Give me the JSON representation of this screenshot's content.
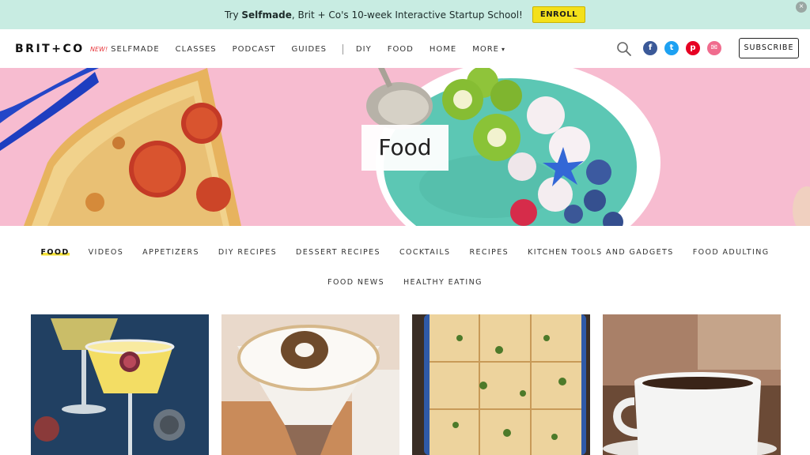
{
  "promo": {
    "text_prefix": "Try ",
    "text_bold": "Selfmade",
    "text_suffix": ", Brit + Co's 10-week Interactive Startup School!",
    "cta_label": "ENROLL",
    "close_icon": "close-icon"
  },
  "header": {
    "logo": "BRIT+CO",
    "new_badge": "NEW!",
    "nav": [
      {
        "label": "SELFMADE"
      },
      {
        "label": "CLASSES"
      },
      {
        "label": "PODCAST"
      },
      {
        "label": "GUIDES"
      },
      {
        "label": "DIY"
      },
      {
        "label": "FOOD"
      },
      {
        "label": "HOME"
      },
      {
        "label": "MORE"
      }
    ],
    "more_icon": "chevron-down-icon",
    "search_icon": "search-icon",
    "social": [
      {
        "icon": "facebook-icon",
        "glyph": "f",
        "color": "#3b5998"
      },
      {
        "icon": "twitter-icon",
        "glyph": "t",
        "color": "#1da1f2"
      },
      {
        "icon": "pinterest-icon",
        "glyph": "p",
        "color": "#e60023"
      },
      {
        "icon": "email-icon",
        "glyph": "✉",
        "color": "#f06c8e"
      }
    ],
    "subscribe_label": "SUBSCRIBE"
  },
  "hero": {
    "title": "Food",
    "background_color": "#f7bcd0"
  },
  "categories": {
    "row1": [
      "FOOD",
      "VIDEOS",
      "APPETIZERS",
      "DIY RECIPES",
      "DESSERT RECIPES",
      "COCKTAILS",
      "RECIPES",
      "KITCHEN TOOLS AND GADGETS",
      "FOOD ADULTING"
    ],
    "row2": [
      "FOOD NEWS",
      "HEALTHY EATING"
    ],
    "active": "FOOD",
    "highlight_color": "#f5e23a"
  },
  "cards": [
    {
      "image": "margarita-cocktail-image"
    },
    {
      "image": "coconut-cookie-dessert-image"
    },
    {
      "image": "baked-casserole-image"
    },
    {
      "image": "coffee-cup-image"
    }
  ]
}
